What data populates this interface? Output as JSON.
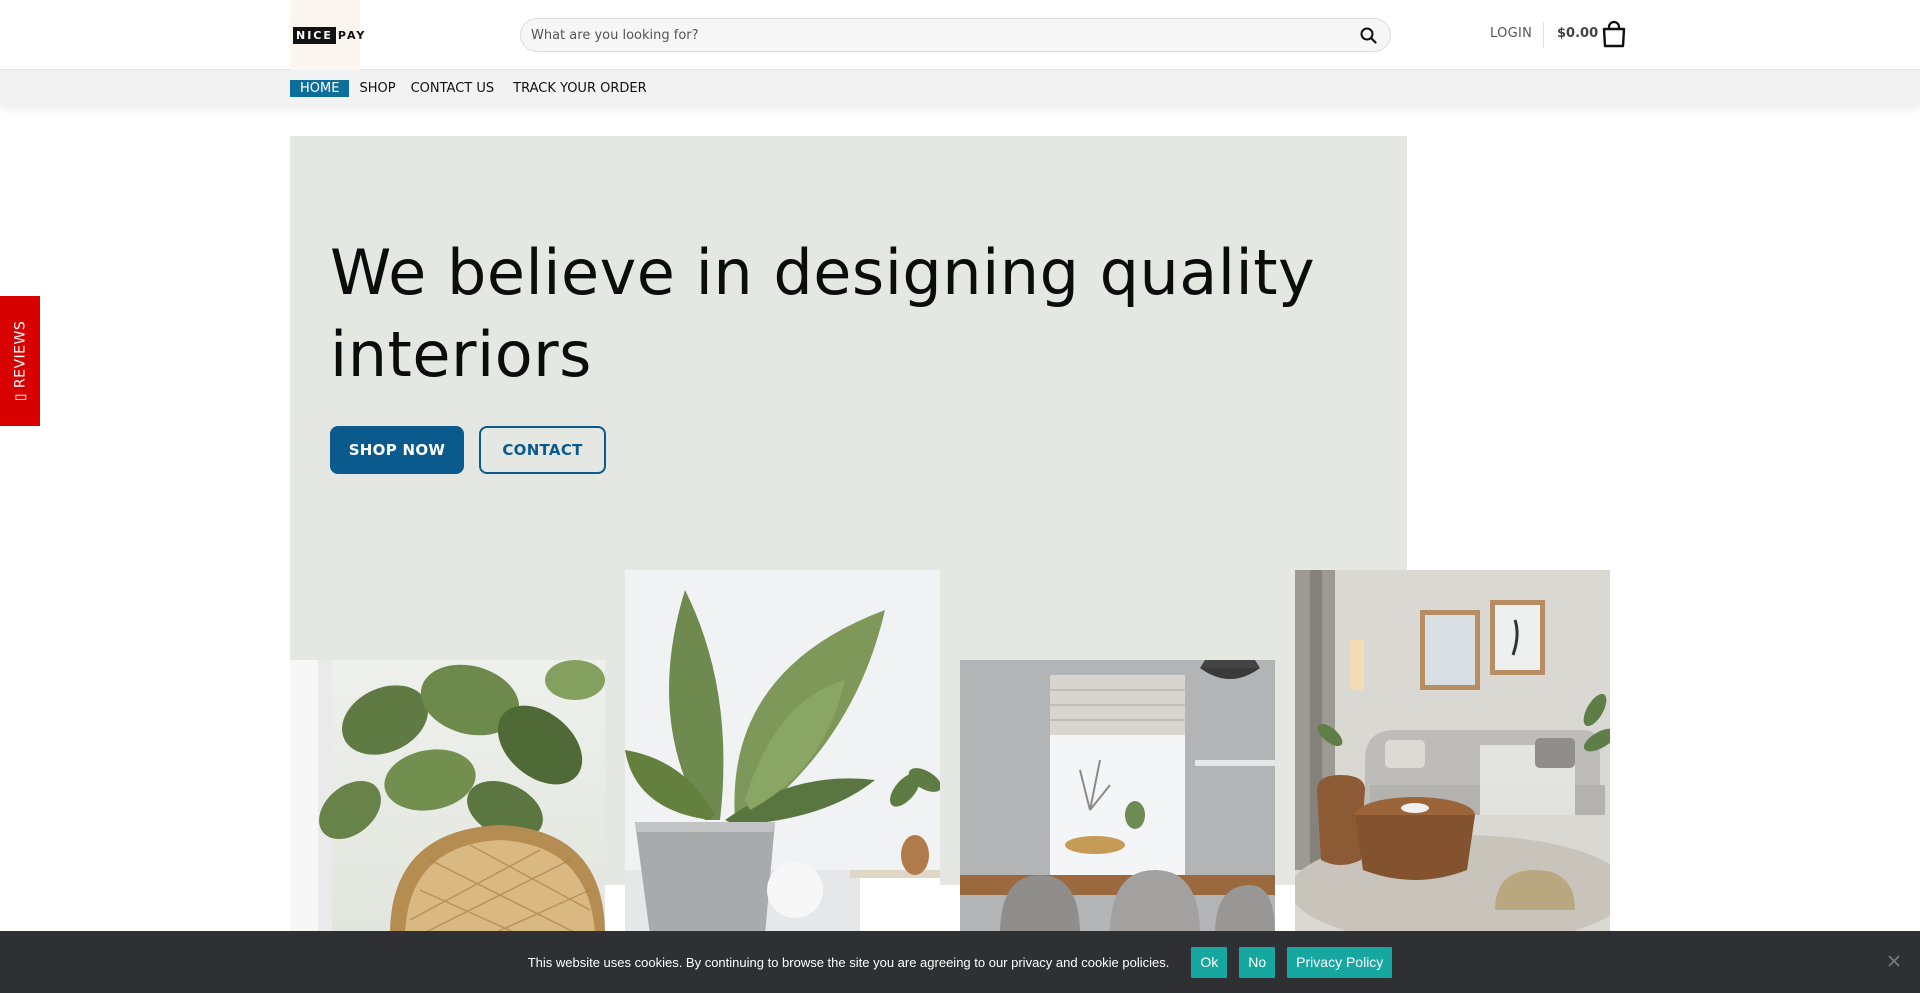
{
  "brand": {
    "logo_part1": "NICE",
    "logo_part2": "PAY"
  },
  "header": {
    "search_placeholder": "What are you looking for?",
    "search_icon": "search-icon",
    "login_label": "LOGIN",
    "cart_total": "$0.00",
    "cart_icon": "shopping-bag-icon"
  },
  "nav": {
    "items": [
      {
        "label": "HOME",
        "active": true
      },
      {
        "label": "SHOP",
        "active": false
      },
      {
        "label": "CONTACT US",
        "active": false
      },
      {
        "label": "TRACK YOUR ORDER",
        "active": false
      }
    ]
  },
  "hero": {
    "title_line1": "We believe in designing quality",
    "title_line2": "interiors",
    "shop_button": "SHOP NOW",
    "contact_button": "CONTACT"
  },
  "side_tab": {
    "label": "REVIEWS",
    "icon": "star-icon"
  },
  "cookie_bar": {
    "message": "This website uses cookies. By continuing to browse the site you are agreeing to our privacy and cookie policies.",
    "ok_label": "Ok",
    "no_label": "No",
    "policy_label": "Privacy Policy",
    "close_icon": "close-icon"
  },
  "colors": {
    "accent": "#0a5a8e",
    "nav_active": "#0d6e9a",
    "hero_bg": "#e5e8e2",
    "reviews_tab": "#d90000",
    "cookie_bg": "#2f3034",
    "cookie_button": "#15a7a0"
  }
}
